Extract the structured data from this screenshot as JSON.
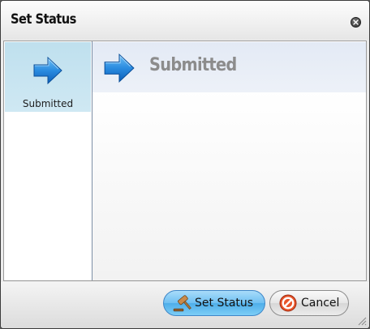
{
  "dialog": {
    "title": "Set Status"
  },
  "sidebar": {
    "items": [
      {
        "label": "Submitted",
        "icon": "right-arrow-icon",
        "selected": true
      }
    ]
  },
  "main": {
    "heading": "Submitted",
    "icon": "right-arrow-icon"
  },
  "footer": {
    "set_status_label": "Set Status",
    "set_status_icon": "gavel-icon",
    "cancel_label": "Cancel",
    "cancel_icon": "cancel-icon"
  },
  "colors": {
    "arrow_blue": "#1f7ed6",
    "selected_bg": "#c6e4f1",
    "header_bg": "#e6ecf6",
    "heading_text": "#8c8c8c"
  }
}
